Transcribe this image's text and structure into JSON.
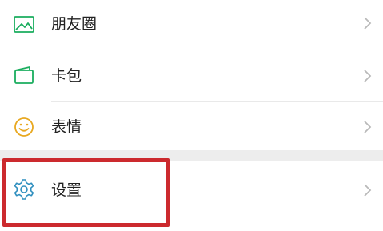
{
  "menu": {
    "items": [
      {
        "label": "朋友圈",
        "icon": "moments-image-icon"
      },
      {
        "label": "卡包",
        "icon": "card-wallet-icon"
      },
      {
        "label": "表情",
        "icon": "smiley-face-icon"
      }
    ],
    "settings": {
      "label": "设置",
      "icon": "gear-icon"
    }
  },
  "colors": {
    "icon_accent": "#1aad5e",
    "emoji_accent": "#e8a820",
    "highlight_border": "#cc2a2e",
    "chevron": "#b9b9b9",
    "separator": "#ededed"
  }
}
